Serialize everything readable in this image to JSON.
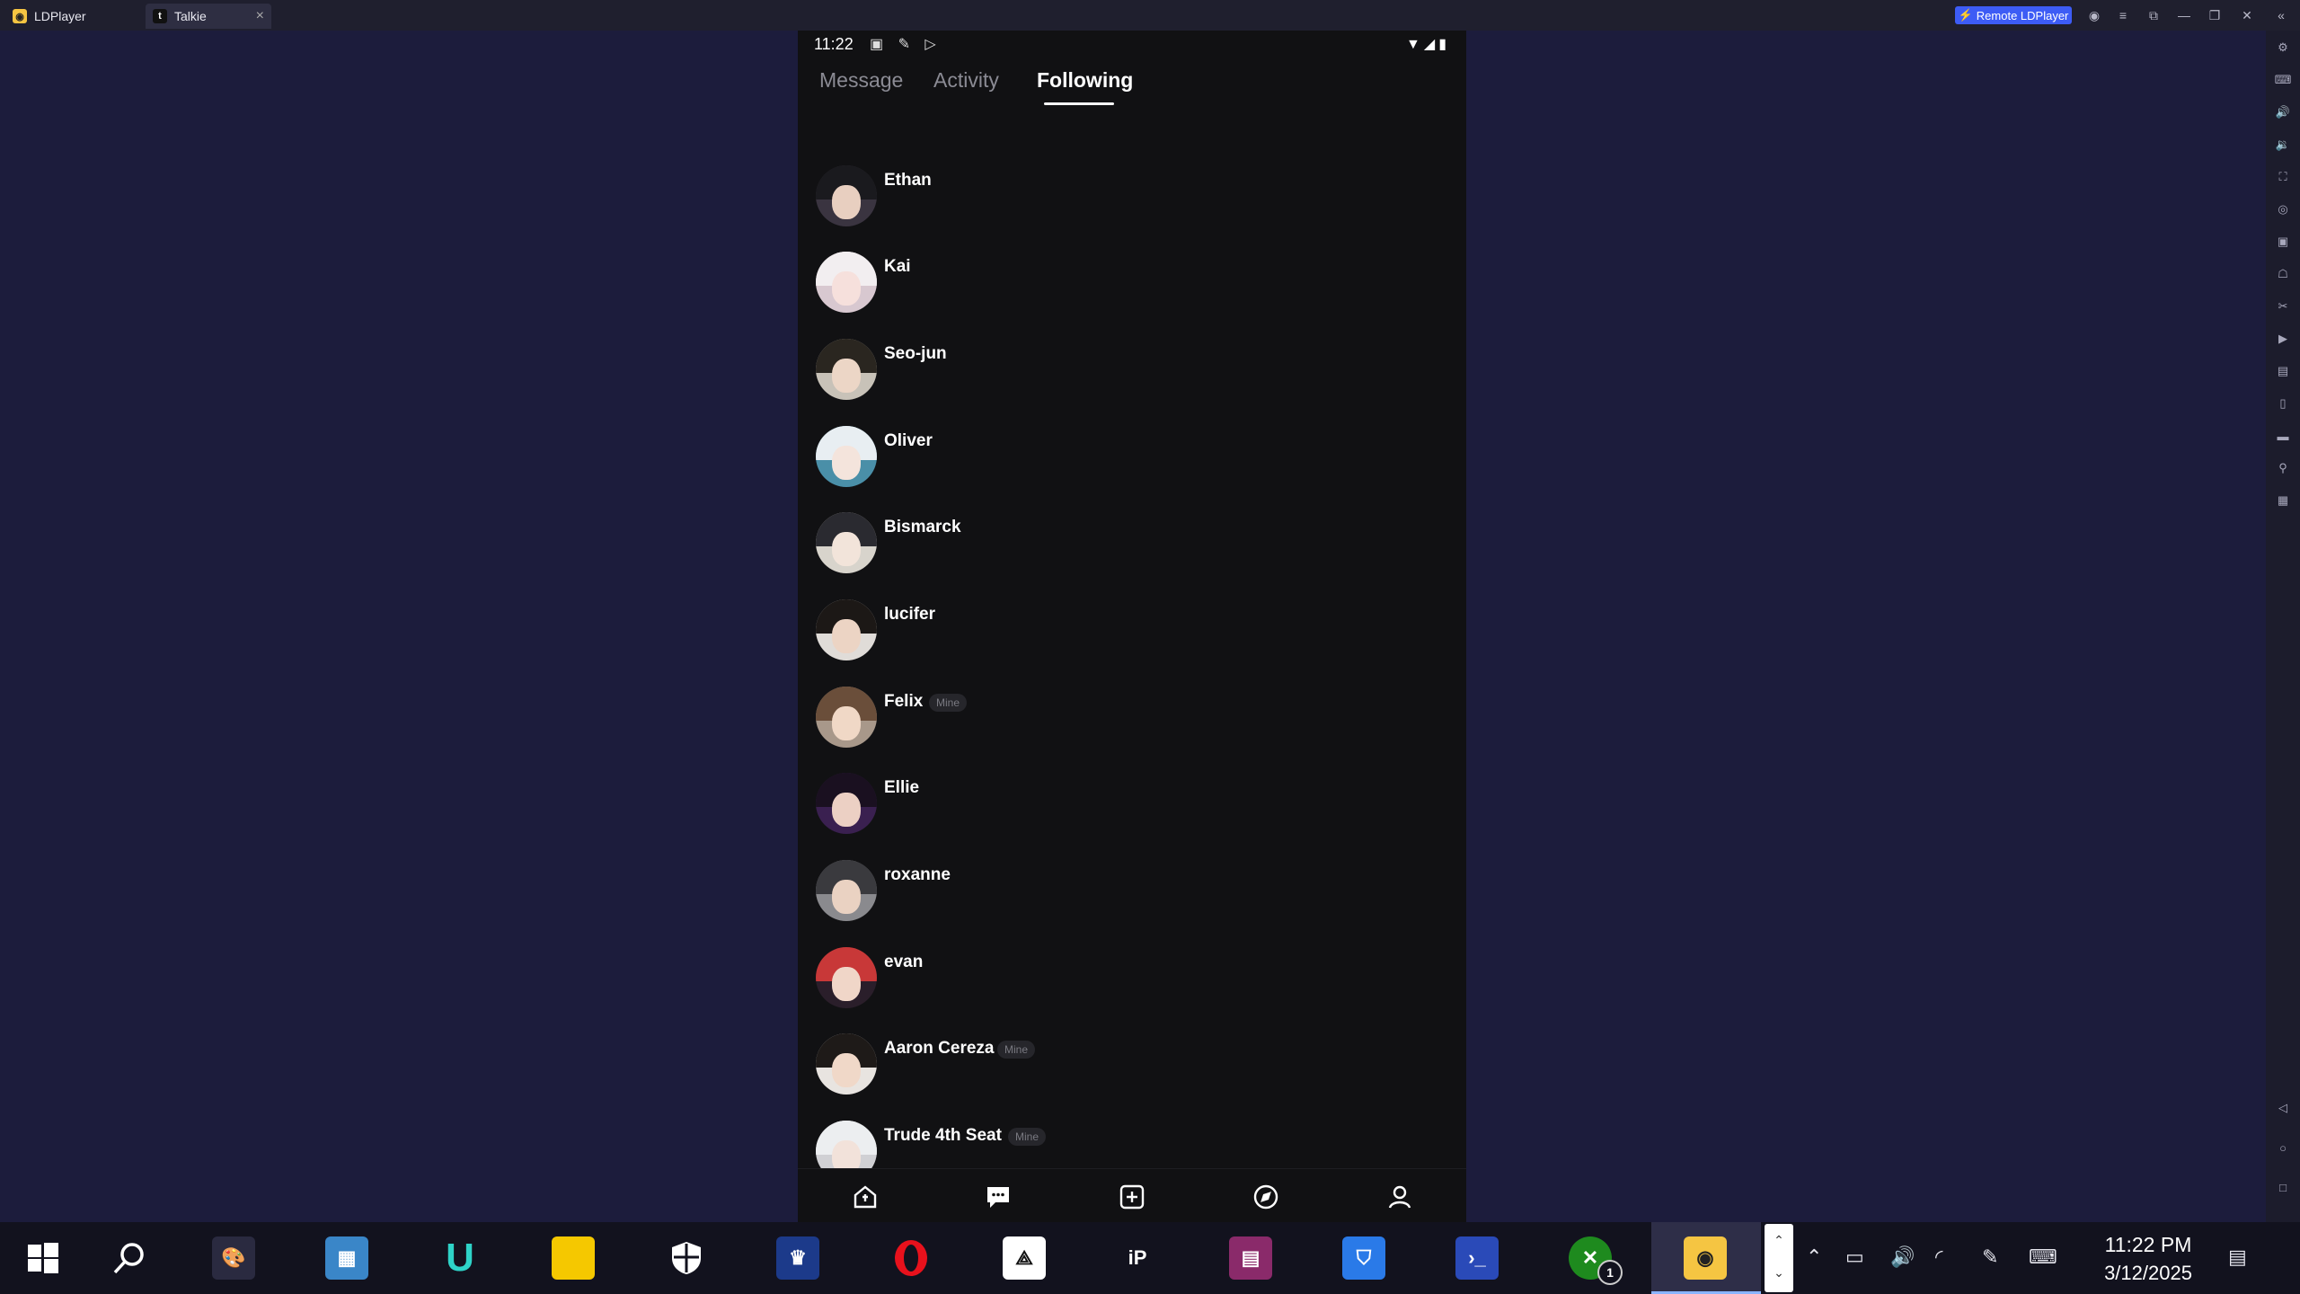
{
  "emulator": {
    "tabs": [
      {
        "label": "LDPlayer",
        "icon": "ldplayer-icon"
      },
      {
        "label": "Talkie",
        "icon": "talkie-icon"
      }
    ],
    "remote_button": "Remote LDPlayer"
  },
  "phone": {
    "status": {
      "time": "11:22"
    },
    "tabs": [
      {
        "label": "Message"
      },
      {
        "label": "Activity"
      },
      {
        "label": "Following"
      }
    ],
    "active_tab": "Following",
    "following": [
      {
        "name": "Ethan",
        "badge": ""
      },
      {
        "name": "Kai",
        "badge": ""
      },
      {
        "name": "Seo-jun",
        "badge": ""
      },
      {
        "name": "Oliver",
        "badge": ""
      },
      {
        "name": "Bismarck",
        "badge": ""
      },
      {
        "name": "lucifer",
        "badge": ""
      },
      {
        "name": "Felix",
        "badge": "Mine"
      },
      {
        "name": "Ellie",
        "badge": ""
      },
      {
        "name": "roxanne",
        "badge": ""
      },
      {
        "name": "evan",
        "badge": ""
      },
      {
        "name": "Aaron Cereza",
        "badge": "Mine"
      },
      {
        "name": "Trude 4th Seat",
        "badge": "Mine"
      }
    ],
    "bottom_nav": [
      "home-icon",
      "chat-icon",
      "create-icon",
      "explore-icon",
      "profile-icon"
    ]
  },
  "taskbar": {
    "clock_time": "11:22 PM",
    "clock_date": "3/12/2025",
    "xbox_badge": "1"
  }
}
